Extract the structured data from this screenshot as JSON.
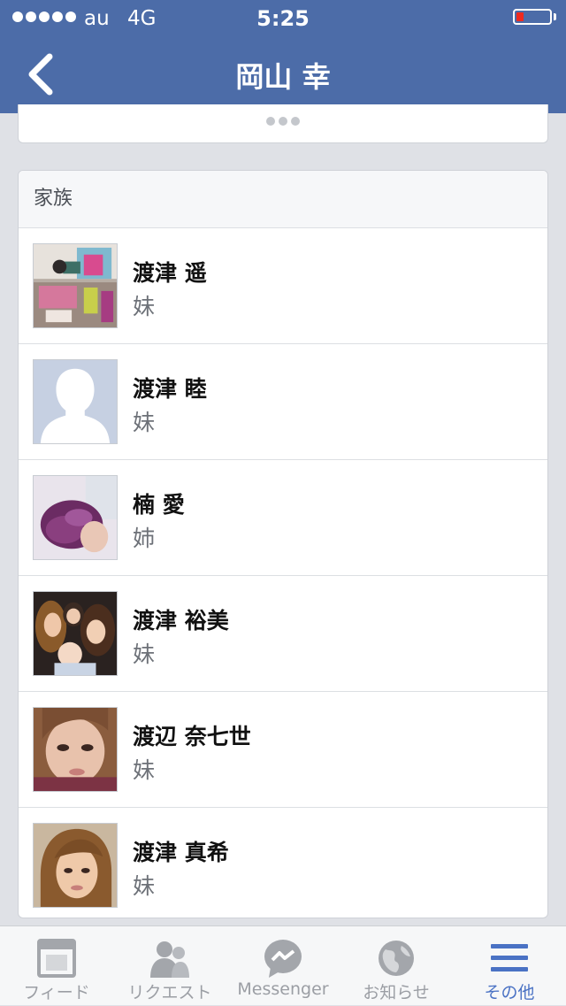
{
  "status_bar": {
    "carrier": "au",
    "network": "4G",
    "time": "5:25"
  },
  "nav": {
    "title": "岡山 幸"
  },
  "family": {
    "header": "家族",
    "members": [
      {
        "name": "渡津 遥",
        "relation": "妹"
      },
      {
        "name": "渡津 睦",
        "relation": "妹"
      },
      {
        "name": "楠 愛",
        "relation": "姉"
      },
      {
        "name": "渡津 裕美",
        "relation": "妹"
      },
      {
        "name": "渡辺 奈七世",
        "relation": "妹"
      },
      {
        "name": "渡津 真希",
        "relation": "妹"
      }
    ]
  },
  "tabs": [
    {
      "label": "フィード",
      "icon": "feed-icon"
    },
    {
      "label": "リクエスト",
      "icon": "friend-requests-icon"
    },
    {
      "label": "Messenger",
      "icon": "messenger-icon"
    },
    {
      "label": "お知らせ",
      "icon": "globe-notifications-icon"
    },
    {
      "label": "その他",
      "icon": "menu-icon",
      "active": true
    }
  ],
  "colors": {
    "nav_bar": "#4c6ca8",
    "active_tab": "#4a72c4",
    "inactive_tab": "#9b9ea4",
    "battery_low": "#ef2a1f"
  }
}
